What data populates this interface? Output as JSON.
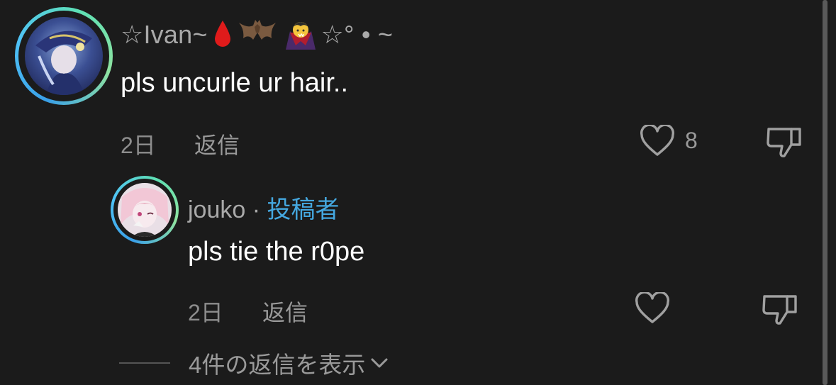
{
  "comment": {
    "username": "☆Ivan~",
    "username_suffix": "☆° • ~",
    "text": "pls uncurle ur hair..",
    "time": "2日",
    "reply_label": "返信",
    "like_count": "8"
  },
  "reply": {
    "username": "jouko",
    "separator": " · ",
    "author_badge": "投稿者",
    "text": "pls tie the r0pe",
    "time": "2日",
    "reply_label": "返信"
  },
  "view_replies_label": "4件の返信を表示",
  "colors": {
    "background": "#1b1b1b",
    "author_badge": "#45a8e0",
    "avatar_ring": [
      "#3aa0e8",
      "#5ee0b4"
    ]
  },
  "icons": [
    "heart-outline-icon",
    "thumbs-down-icon",
    "chevron-down-icon",
    "blood-drop-emoji",
    "bat-emoji",
    "vampire-emoji"
  ]
}
